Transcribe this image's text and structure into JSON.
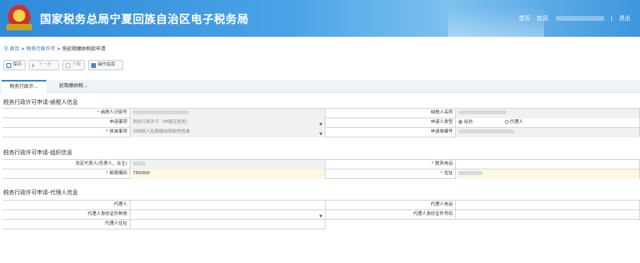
{
  "header": {
    "title": "国家税务总局宁夏回族自治区电子税务局",
    "home": "首页",
    "welcome": "欢迎,",
    "separator": "|",
    "logout": "退出"
  },
  "breadcrumb": {
    "home": "首页",
    "sep1": ">",
    "level2": "税务行政许可",
    "sep2": ">",
    "current": "拖延期缴纳税款申请"
  },
  "toolbar": {
    "save": "保存",
    "next": "下一步",
    "download": "下载",
    "guide": "操作指南"
  },
  "tabs": [
    {
      "label": "税务行政许..."
    },
    {
      "label": "延期缴纳税..."
    }
  ],
  "section1": {
    "title": "税务行政许可申请-纳税人信息",
    "taxpayer_id_label": "纳税人识别号",
    "taxpayer_name_label": "纳税人名称",
    "apply_item_label": "申请事项",
    "apply_item_value": "税务行政许可（申报征收类）",
    "applicant_type_label": "申请人类型",
    "applicant_type_options": [
      "经办",
      "代理人"
    ],
    "sub_item_label": "核准事项",
    "sub_item_value": "对纳税人延期缴纳税款的核准",
    "apply_no_label": "申请单编号"
  },
  "section2": {
    "title": "税务行政许可申请-组织信息",
    "legal_rep_label": "法定代表人(负责人、业主)",
    "phone_label": "联系电话",
    "postcode_label": "邮政编码",
    "postcode_value": "750000",
    "address_label": "住址"
  },
  "section3": {
    "title": "税务行政许可申请-代理人信息",
    "agent_label": "代理人",
    "agent_phone_label": "代理人电话",
    "agent_id_type_label": "代理人身份证件种类",
    "agent_id_no_label": "代理人身份证件号码",
    "agent_address_label": "代理人住址"
  },
  "colors": {
    "header": "#3d96dc",
    "required": "#d9302a",
    "link": "#2f6fb7",
    "highlight": "#fdf8e2"
  }
}
